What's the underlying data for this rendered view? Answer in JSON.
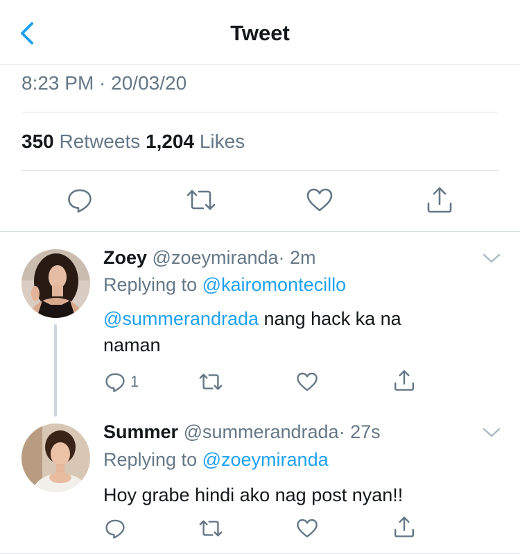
{
  "header": {
    "title": "Tweet"
  },
  "tweet": {
    "timestamp": "8:23 PM · 20/03/20",
    "retweets_count": "350",
    "retweets_label": "Retweets",
    "likes_count": "1,204",
    "likes_label": "Likes"
  },
  "replies": [
    {
      "name": "Zoey",
      "handle": "@zoeymiranda",
      "time": "· 2m",
      "replying_prefix": "Replying to",
      "replying_to": "@kairomontecillo",
      "mention": "@summerandrada",
      "text_after_mention": " nang hack ka na naman",
      "reply_count": "1"
    },
    {
      "name": "Summer",
      "handle": "@summerandrada",
      "time": "· 27s",
      "replying_prefix": "Replying to",
      "replying_to": "@zoeymiranda",
      "text": "Hoy grabe hindi ako nag post nyan!!"
    }
  ],
  "colors": {
    "accent": "#1da1f2",
    "secondary_text": "#657786",
    "divider": "#d9dee2"
  }
}
